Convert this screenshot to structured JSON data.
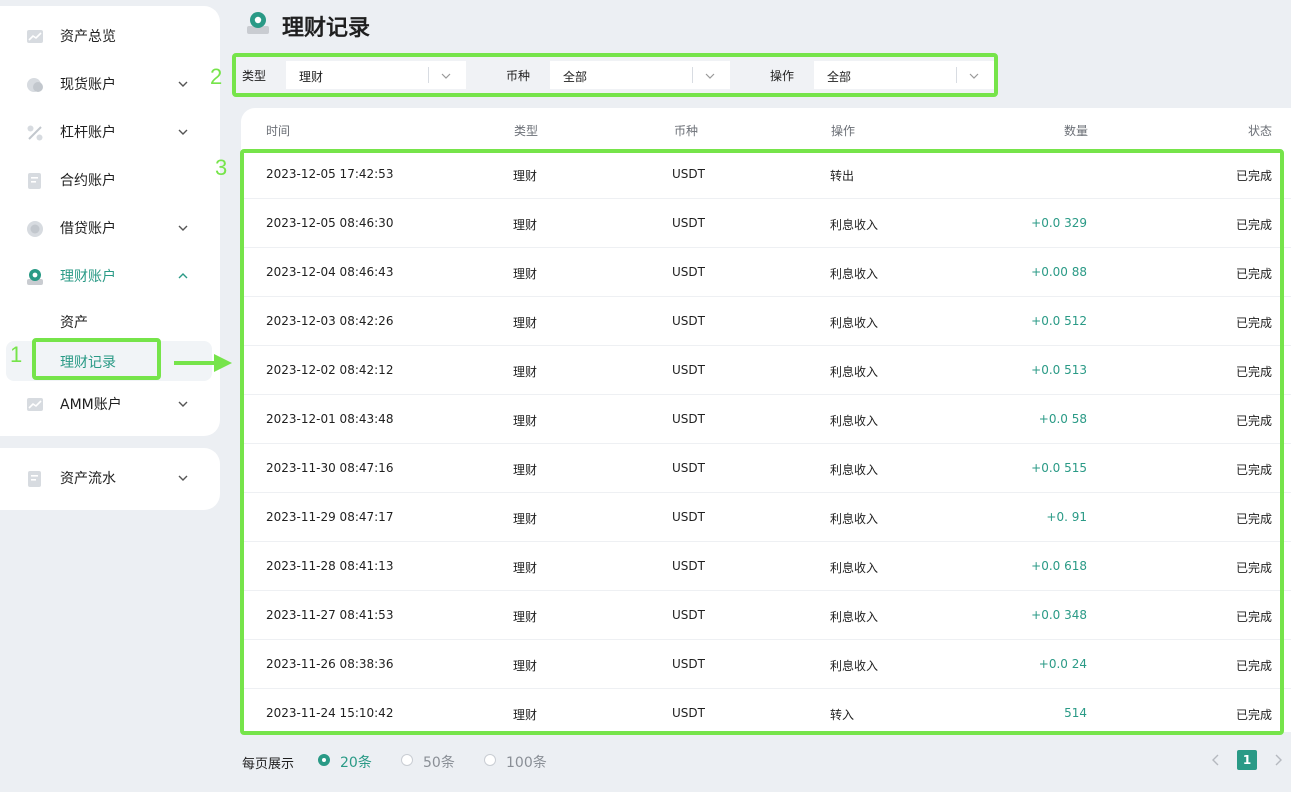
{
  "sidebar": {
    "items": [
      {
        "label": "资产总览",
        "icon": "chart-line-icon",
        "has_chevron": false
      },
      {
        "label": "现货账户",
        "icon": "coin-icon",
        "has_chevron": true
      },
      {
        "label": "杠杆账户",
        "icon": "percent-icon",
        "has_chevron": true
      },
      {
        "label": "合约账户",
        "icon": "document-icon",
        "has_chevron": false
      },
      {
        "label": "借贷账户",
        "icon": "coin-icon",
        "has_chevron": true
      },
      {
        "label": "理财账户",
        "icon": "wealth-icon",
        "has_chevron": true,
        "expanded": true
      },
      {
        "label": "AMM账户",
        "icon": "chart-line-icon",
        "has_chevron": true
      }
    ],
    "sub_items": [
      {
        "label": "资产"
      },
      {
        "label": "理财记录",
        "active": true
      }
    ],
    "bottom_item": {
      "label": "资产流水",
      "icon": "document-icon",
      "has_chevron": true
    }
  },
  "page": {
    "title": "理财记录",
    "title_icon": "wealth-icon"
  },
  "filters": {
    "type": {
      "label": "类型",
      "value": "理财"
    },
    "coin": {
      "label": "币种",
      "value": "全部"
    },
    "operation": {
      "label": "操作",
      "value": "全部"
    }
  },
  "table": {
    "headers": {
      "time": "时间",
      "type": "类型",
      "coin": "币种",
      "operation": "操作",
      "quantity": "数量",
      "status": "状态"
    },
    "rows": [
      {
        "time": "2023-12-05 17:42:53",
        "type": "理财",
        "coin": "USDT",
        "operation": "转出",
        "quantity": "",
        "status": "已完成"
      },
      {
        "time": "2023-12-05 08:46:30",
        "type": "理财",
        "coin": "USDT",
        "operation": "利息收入",
        "quantity": "+0.0 329",
        "status": "已完成"
      },
      {
        "time": "2023-12-04 08:46:43",
        "type": "理财",
        "coin": "USDT",
        "operation": "利息收入",
        "quantity": "+0.00 88",
        "status": "已完成"
      },
      {
        "time": "2023-12-03 08:42:26",
        "type": "理财",
        "coin": "USDT",
        "operation": "利息收入",
        "quantity": "+0.0 512",
        "status": "已完成"
      },
      {
        "time": "2023-12-02 08:42:12",
        "type": "理财",
        "coin": "USDT",
        "operation": "利息收入",
        "quantity": "+0.0 513",
        "status": "已完成"
      },
      {
        "time": "2023-12-01 08:43:48",
        "type": "理财",
        "coin": "USDT",
        "operation": "利息收入",
        "quantity": "+0.0 58",
        "status": "已完成"
      },
      {
        "time": "2023-11-30 08:47:16",
        "type": "理财",
        "coin": "USDT",
        "operation": "利息收入",
        "quantity": "+0.0 515",
        "status": "已完成"
      },
      {
        "time": "2023-11-29 08:47:17",
        "type": "理财",
        "coin": "USDT",
        "operation": "利息收入",
        "quantity": "+0. 91",
        "status": "已完成"
      },
      {
        "time": "2023-11-28 08:41:13",
        "type": "理财",
        "coin": "USDT",
        "operation": "利息收入",
        "quantity": "+0.0 618",
        "status": "已完成"
      },
      {
        "time": "2023-11-27 08:41:53",
        "type": "理财",
        "coin": "USDT",
        "operation": "利息收入",
        "quantity": "+0.0 348",
        "status": "已完成"
      },
      {
        "time": "2023-11-26 08:38:36",
        "type": "理财",
        "coin": "USDT",
        "operation": "利息收入",
        "quantity": "+0.0 24",
        "status": "已完成"
      },
      {
        "time": "2023-11-24 15:10:42",
        "type": "理财",
        "coin": "USDT",
        "operation": "转入",
        "quantity": "514",
        "status": "已完成"
      }
    ]
  },
  "pagination": {
    "per_page_label": "每页展示",
    "options": [
      {
        "label": "20条",
        "checked": true
      },
      {
        "label": "50条",
        "checked": false
      },
      {
        "label": "100条",
        "checked": false
      }
    ],
    "current_page": "1"
  },
  "annotations": {
    "numbers": [
      "1",
      "2",
      "3"
    ],
    "color": "#76e44a"
  },
  "colors": {
    "accent": "#2a9a86",
    "background": "#eceff3"
  }
}
